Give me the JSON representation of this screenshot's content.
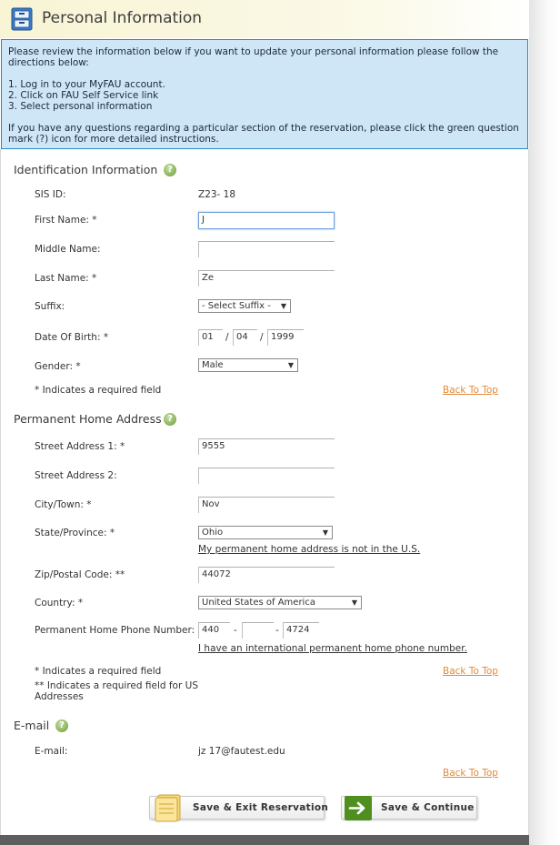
{
  "header": {
    "title": "Personal Information"
  },
  "info": {
    "intro": "Please review the information below if you want to update your personal information please follow the directions below:",
    "steps": [
      "1. Log in to your MyFAU account.",
      "2. Click on FAU Self Service link",
      "3. Select personal information"
    ],
    "help_note": "If you have any questions regarding a particular section of the reservation, please click the green question mark (?) icon for more detailed instructions."
  },
  "help_symbol": "?",
  "identification": {
    "title": "Identification Information",
    "sis_id_label": "SIS ID:",
    "sis_id_value": "Z23-    18",
    "first_name_label": "First Name: *",
    "first_name_value": "J",
    "middle_name_label": "Middle Name:",
    "middle_name_value": "",
    "last_name_label": "Last Name: *",
    "last_name_value": "Ze",
    "suffix_label": "Suffix:",
    "suffix_value": "- Select Suffix -",
    "dob_label": "Date Of Birth: *",
    "dob_month": "01",
    "dob_day": "04",
    "dob_year": "1999",
    "date_separator": "/",
    "gender_label": "Gender: *",
    "gender_value": "Male",
    "required_note": "* Indicates a required field",
    "back_to_top": "Back To Top"
  },
  "address": {
    "title": "Permanent Home Address",
    "street1_label": "Street Address 1: *",
    "street1_value": "9555",
    "street2_label": "Street Address 2:",
    "street2_value": "",
    "city_label": "City/Town: *",
    "city_value": "Nov",
    "state_label": "State/Province: *",
    "state_value": "Ohio",
    "not_us_link": "My permanent home address is not in the U.S.",
    "zip_label": "Zip/Postal Code: **",
    "zip_value": "44072",
    "country_label": "Country: *",
    "country_value": "United States of America",
    "phone_label": "Permanent Home Phone Number: *",
    "phone_area": "440",
    "phone_prefix": "",
    "phone_line": "4724",
    "phone_separator": "-",
    "intl_phone_link": "I have an international permanent home phone number.",
    "required_note": "* Indicates a required field",
    "us_required_note": "** Indicates a required field for US Addresses",
    "back_to_top": "Back To Top"
  },
  "email": {
    "title": "E-mail",
    "label": "E-mail:",
    "value": "jz    17@fautest.edu",
    "back_to_top": "Back To Top"
  },
  "buttons": {
    "save_exit": "Save & Exit Reservation",
    "save_continue": "Save & Continue"
  },
  "icons": {
    "header": "filing-cabinet-icon",
    "help": "question-mark-icon",
    "save_exit": "notepad-icon",
    "save_continue": "arrow-right-icon"
  },
  "colors": {
    "info_bg": "#cfe6f6",
    "info_border": "#2a8ac2",
    "back_to_top": "#e28a3a",
    "help_green": "#86b055",
    "arrow_green": "#4f8f1f"
  }
}
